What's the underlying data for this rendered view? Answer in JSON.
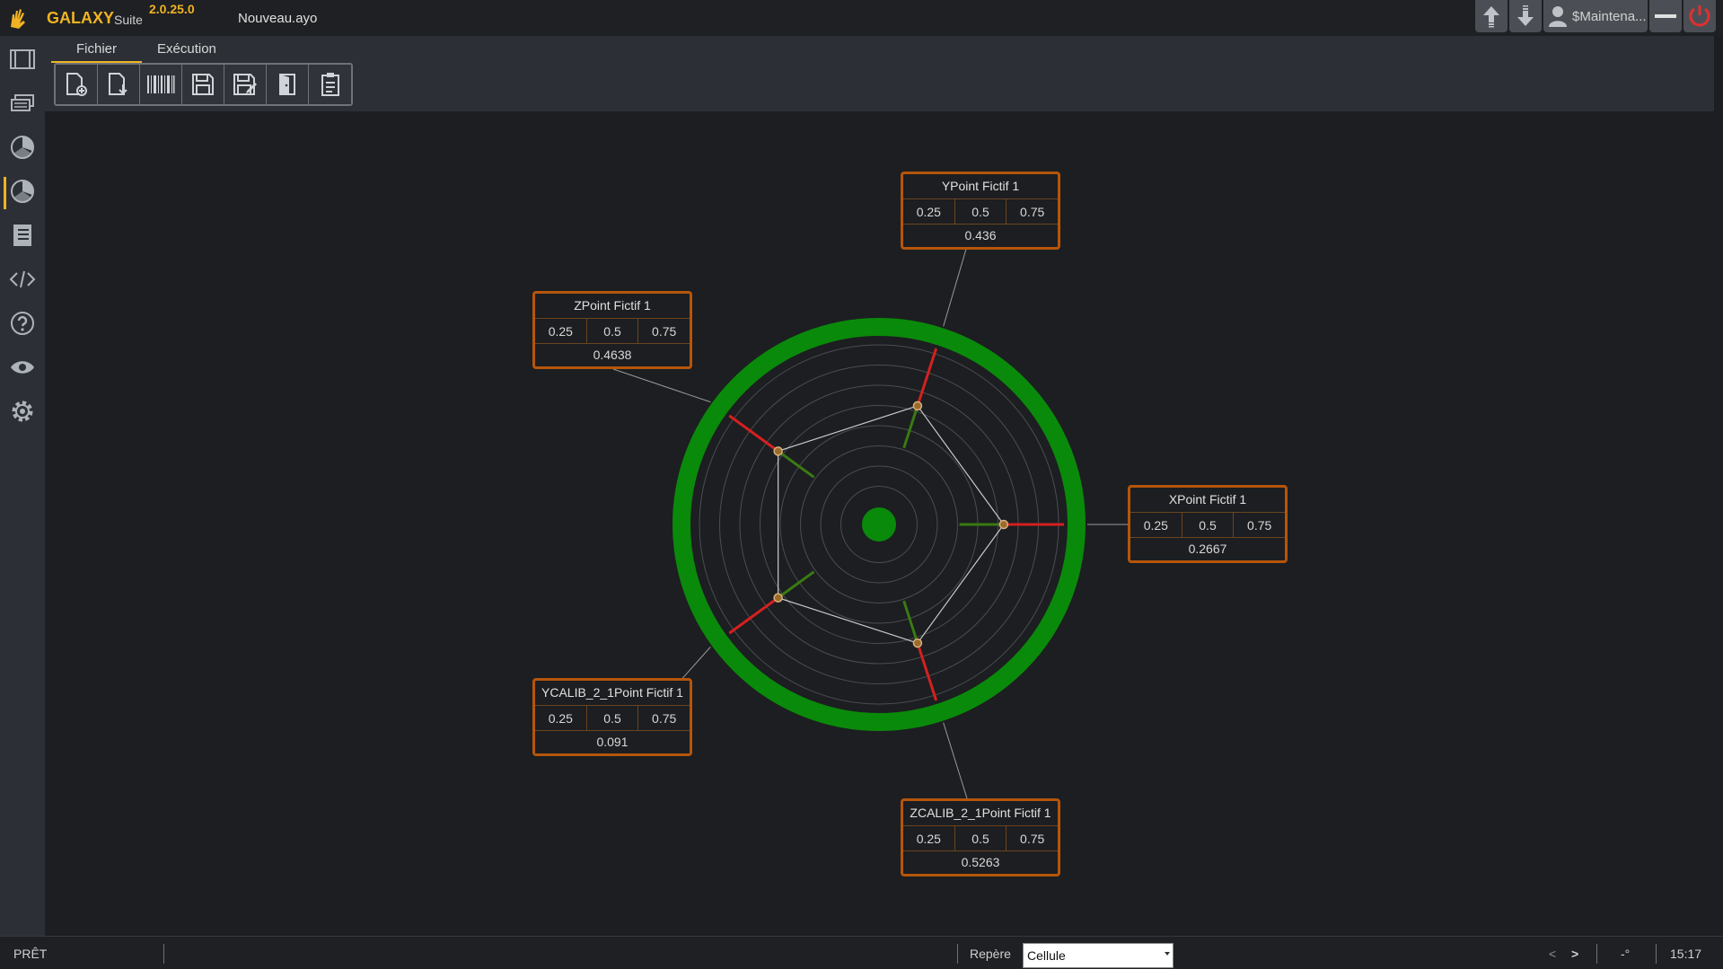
{
  "app": {
    "name": "GALAXY",
    "suite": "Suite",
    "version": "2.0.25.0",
    "document": "Nouveau.ayo"
  },
  "window_controls": {
    "user": "$Maintena..."
  },
  "sidebar": {
    "items": [
      {
        "icon": "film-frame-icon"
      },
      {
        "icon": "stacked-layers-icon"
      },
      {
        "icon": "pie-chart-icon"
      },
      {
        "icon": "radar-pie-icon",
        "active": true
      },
      {
        "icon": "notebook-icon"
      },
      {
        "icon": "code-icon"
      },
      {
        "icon": "help-icon"
      },
      {
        "icon": "eye-icon"
      },
      {
        "icon": "gear-icon"
      }
    ]
  },
  "ribbon": {
    "tabs": [
      {
        "label": "Fichier",
        "active": true
      },
      {
        "label": "Exécution"
      }
    ],
    "tools": [
      "new-file-icon",
      "import-file-icon",
      "barcode-icon",
      "save-icon",
      "save-as-icon",
      "exit-door-icon",
      "clipboard-list-icon"
    ]
  },
  "points": [
    {
      "name": "YPoint Fictif 1",
      "thresholds": [
        "0.25",
        "0.5",
        "0.75"
      ],
      "value": "0.436"
    },
    {
      "name": "XPoint Fictif 1",
      "thresholds": [
        "0.25",
        "0.5",
        "0.75"
      ],
      "value": "0.2667"
    },
    {
      "name": "ZCALIB_2_1Point Fictif 1",
      "thresholds": [
        "0.25",
        "0.5",
        "0.75"
      ],
      "value": "0.5263"
    },
    {
      "name": "YCALIB_2_1Point Fictif 1",
      "thresholds": [
        "0.25",
        "0.5",
        "0.75"
      ],
      "value": "0.091"
    },
    {
      "name": "ZPoint Fictif 1",
      "thresholds": [
        "0.25",
        "0.5",
        "0.75"
      ],
      "value": "0.4638"
    }
  ],
  "status": {
    "state": "PRÊT",
    "repere_label": "Repère",
    "repere_value": "Cellule",
    "nav_prev": "<",
    "nav_next": ">",
    "angle": "-°",
    "time": "15:17"
  },
  "colors": {
    "accent": "#f0b323",
    "ring": "#0a8a0a",
    "box_border": "#b5550b",
    "fail": "#d42020",
    "ok": "#3a7a12"
  }
}
